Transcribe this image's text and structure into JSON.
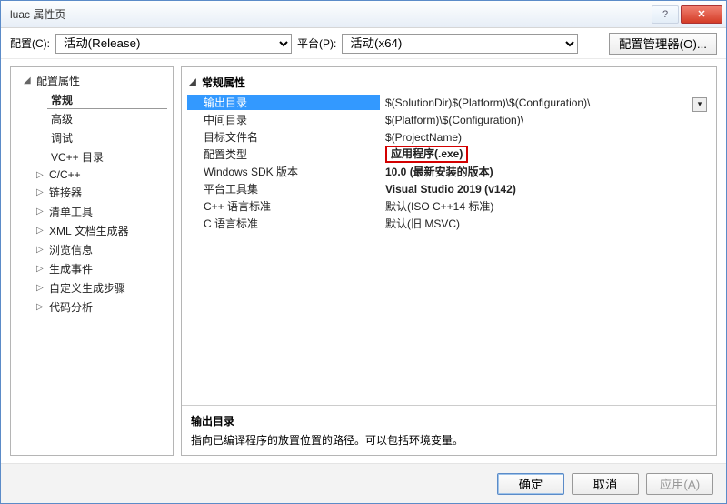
{
  "window": {
    "title": "luac 属性页"
  },
  "configbar": {
    "config_label": "配置(C):",
    "config_value": "活动(Release)",
    "platform_label": "平台(P):",
    "platform_value": "活动(x64)",
    "manager_label": "配置管理器(O)..."
  },
  "tree": {
    "root": "配置属性",
    "items": [
      {
        "label": "常规",
        "selected": true
      },
      {
        "label": "高级"
      },
      {
        "label": "调试"
      },
      {
        "label": "VC++ 目录"
      }
    ],
    "collapsed": [
      "C/C++",
      "链接器",
      "清单工具",
      "XML 文档生成器",
      "浏览信息",
      "生成事件",
      "自定义生成步骤",
      "代码分析"
    ]
  },
  "props": {
    "group": "常规属性",
    "rows": [
      {
        "label": "输出目录",
        "value": "$(SolutionDir)$(Platform)\\$(Configuration)\\",
        "selected": true
      },
      {
        "label": "中间目录",
        "value": "$(Platform)\\$(Configuration)\\"
      },
      {
        "label": "目标文件名",
        "value": "$(ProjectName)"
      },
      {
        "label": "配置类型",
        "value": "应用程序(.exe)",
        "bold": true,
        "redbox": true
      },
      {
        "label": "Windows SDK 版本",
        "value": "10.0 (最新安装的版本)",
        "bold": true
      },
      {
        "label": "平台工具集",
        "value": "Visual Studio 2019 (v142)",
        "bold": true
      },
      {
        "label": "C++ 语言标准",
        "value": "默认(ISO C++14 标准)"
      },
      {
        "label": "C 语言标准",
        "value": "默认(旧 MSVC)"
      }
    ]
  },
  "desc": {
    "title": "输出目录",
    "text": "指向已编译程序的放置位置的路径。可以包括环境变量。"
  },
  "footer": {
    "ok": "确定",
    "cancel": "取消",
    "apply": "应用(A)"
  }
}
